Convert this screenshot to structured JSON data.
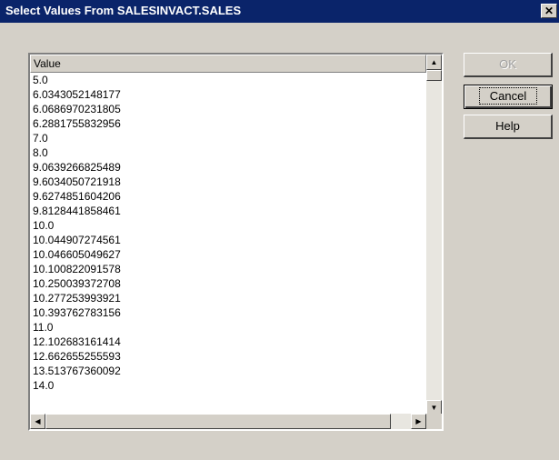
{
  "window": {
    "title": "Select Values From SALESINVACT.SALES",
    "close_glyph": "✕"
  },
  "list": {
    "column_header": "Value",
    "values": [
      "5.0",
      "6.0343052148177",
      "6.0686970231805",
      "6.2881755832956",
      "7.0",
      "8.0",
      "9.0639266825489",
      "9.6034050721918",
      "9.6274851604206",
      "9.8128441858461",
      "10.0",
      "10.044907274561",
      "10.046605049627",
      "10.100822091578",
      "10.250039372708",
      "10.277253993921",
      "10.393762783156",
      "11.0",
      "12.102683161414",
      "12.662655255593",
      "13.513767360092",
      "14.0"
    ]
  },
  "buttons": {
    "ok": "OK",
    "cancel": "Cancel",
    "help": "Help"
  },
  "icons": {
    "scroll_up": "▲",
    "scroll_down": "▼",
    "scroll_left": "◀",
    "scroll_right": "▶"
  }
}
